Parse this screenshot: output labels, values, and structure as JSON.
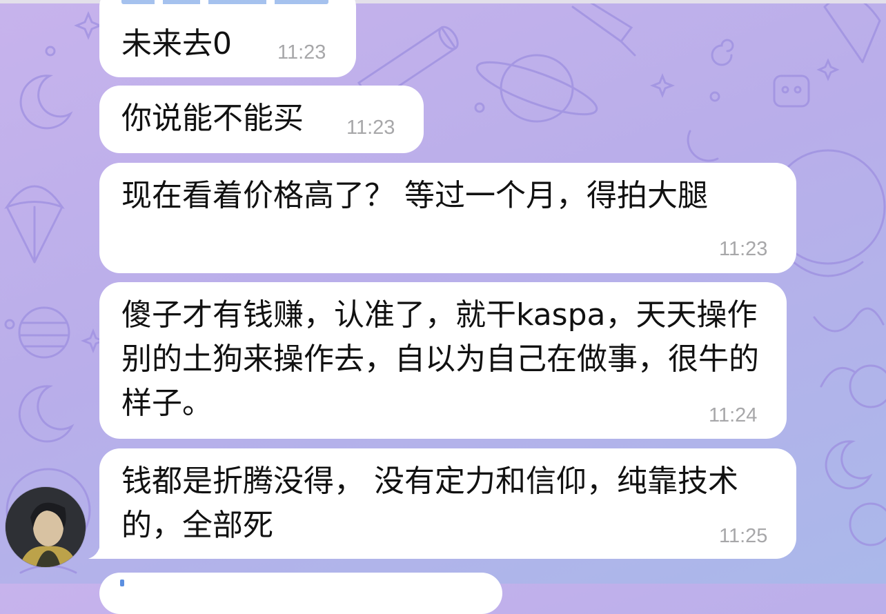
{
  "theme": {
    "bubble_bg": "#ffffff",
    "time_color": "#a7a7a9",
    "wallpaper_top": "#c7b3ec",
    "wallpaper_bottom": "#aab8ea"
  },
  "messages": [
    {
      "text": "未来去0",
      "time": "11:23"
    },
    {
      "text": "你说能不能买",
      "time": "11:23"
    },
    {
      "text": "现在看着价格高了？ 等过一个月，得拍大腿",
      "time": "11:23"
    },
    {
      "text": "傻子才有钱赚，认准了，就干kaspa，天天操作别的土狗来操作去，自以为自己在做事，很牛的样子。",
      "time": "11:24"
    },
    {
      "text": "钱都是折腾没得， 没有定力和信仰，纯靠技术的，全部死",
      "time": "11:25"
    }
  ],
  "sender": {
    "avatar_icon": "user-avatar"
  }
}
